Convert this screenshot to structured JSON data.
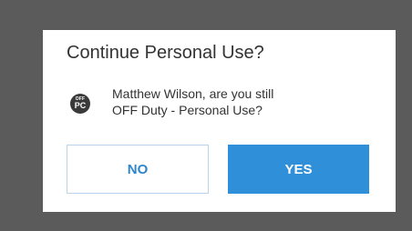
{
  "dialog": {
    "title": "Continue Personal Use?",
    "status_badge": {
      "top_text": "OFF",
      "bottom_text": "PC"
    },
    "message_line1": "Matthew Wilson, are you still",
    "message_line2": "OFF Duty - Personal Use?",
    "buttons": {
      "no_label": "NO",
      "yes_label": "YES"
    }
  },
  "colors": {
    "backdrop": "#5b5b5b",
    "primary": "#2f8fd8",
    "secondary_border": "#b9d3ea"
  }
}
